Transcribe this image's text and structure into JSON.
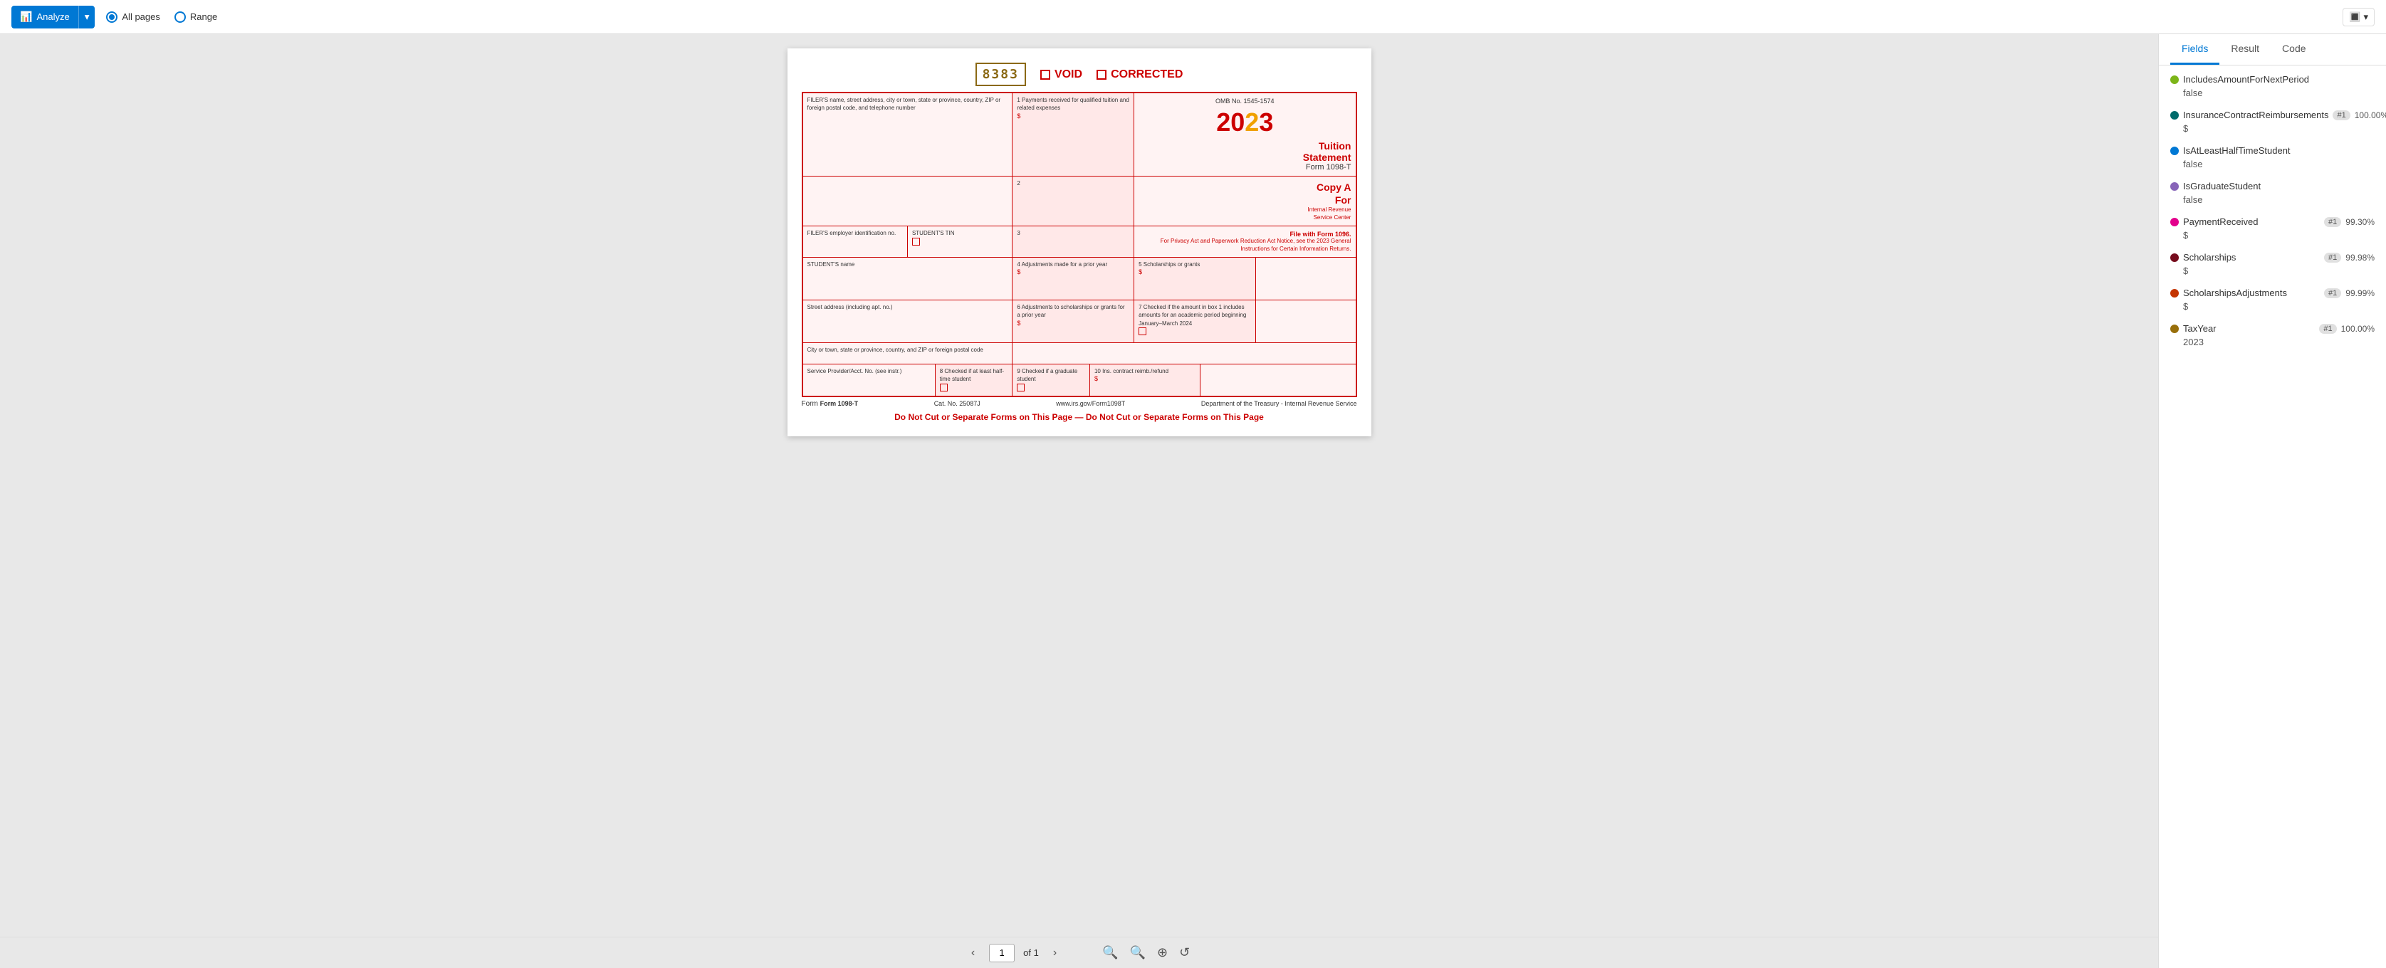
{
  "toolbar": {
    "analyze_label": "Analyze",
    "all_pages_label": "All pages",
    "range_label": "Range",
    "layers_label": "⊕"
  },
  "tabs": {
    "fields": "Fields",
    "result": "Result",
    "code": "Code"
  },
  "form": {
    "barcode": "8383",
    "void_label": "VOID",
    "corrected_label": "CORRECTED",
    "omb": "OMB No. 1545-1574",
    "year": "2023",
    "year_highlight": "0",
    "form_number": "Form 1098-T",
    "title_line1": "Tuition",
    "title_line2": "Statement",
    "copy_a_line1": "Copy A",
    "copy_a_line2": "For",
    "copy_a_line3": "Internal Revenue",
    "copy_a_line4": "Service Center",
    "file_notice": "File with Form 1096.",
    "privacy_notice": "For Privacy Act and Paperwork Reduction Act Notice, see the 2023 General Instructions for Certain Information Returns.",
    "filer_name_label": "FILER'S name, street address, city or town, state or province, country, ZIP or foreign postal code, and telephone number",
    "box1_label": "1 Payments received for qualified tuition and related expenses",
    "box1_dollar": "$",
    "box2_label": "2",
    "filer_ein_label": "FILER'S employer identification no.",
    "student_tin_label": "STUDENT'S TIN",
    "box3_label": "3",
    "student_name_label": "STUDENT'S name",
    "box4_label": "4 Adjustments made for a prior year",
    "box4_dollar": "$",
    "box5_label": "5 Scholarships or grants",
    "box5_dollar": "$",
    "street_label": "Street address (including apt. no.)",
    "box6_label": "6 Adjustments to scholarships or grants for a prior year",
    "box6_dollar": "$",
    "box7_label": "7 Checked if the amount in box 1 includes amounts for an academic period beginning January–March 2024",
    "city_label": "City or town, state or province, country, and ZIP or foreign postal code",
    "service_provider_label": "Service Provider/Acct. No. (see instr.)",
    "box8_label": "8 Checked if at least half-time student",
    "box9_label": "9 Checked if a graduate student",
    "box10_label": "10 Ins. contract reimb./refund",
    "box10_dollar": "$",
    "footer_form": "Form 1098-T",
    "footer_cat": "Cat. No. 25087J",
    "footer_url": "www.irs.gov/Form1098T",
    "footer_dept": "Department of the Treasury - Internal Revenue Service",
    "do_not_cut": "Do Not Cut or Separate Forms on This Page — Do Not Cut or Separate Forms on This Page"
  },
  "pagination": {
    "prev": "‹",
    "next": "›",
    "current_page": "1",
    "of_label": "of 1"
  },
  "fields": [
    {
      "name": "IncludesAmountForNextPeriod",
      "dot_color": "#7cb518",
      "badge": null,
      "confidence": null,
      "value": "false"
    },
    {
      "name": "InsuranceContractReimbursements",
      "dot_color": "#006b6b",
      "badge": "#1",
      "confidence": "100.00%",
      "value": "$"
    },
    {
      "name": "IsAtLeastHalfTimeStudent",
      "dot_color": "#0078d4",
      "badge": null,
      "confidence": null,
      "value": "false"
    },
    {
      "name": "IsGraduateStudent",
      "dot_color": "#8764b8",
      "badge": null,
      "confidence": null,
      "value": "false"
    },
    {
      "name": "PaymentReceived",
      "dot_color": "#e3008c",
      "badge": "#1",
      "confidence": "99.30%",
      "value": "$"
    },
    {
      "name": "Scholarships",
      "dot_color": "#750b1c",
      "badge": "#1",
      "confidence": "99.98%",
      "value": "$"
    },
    {
      "name": "ScholarshipsAdjustments",
      "dot_color": "#c43501",
      "badge": "#1",
      "confidence": "99.99%",
      "value": "$"
    },
    {
      "name": "TaxYear",
      "dot_color": "#986f0b",
      "badge": "#1",
      "confidence": "100.00%",
      "value": "2023"
    }
  ]
}
